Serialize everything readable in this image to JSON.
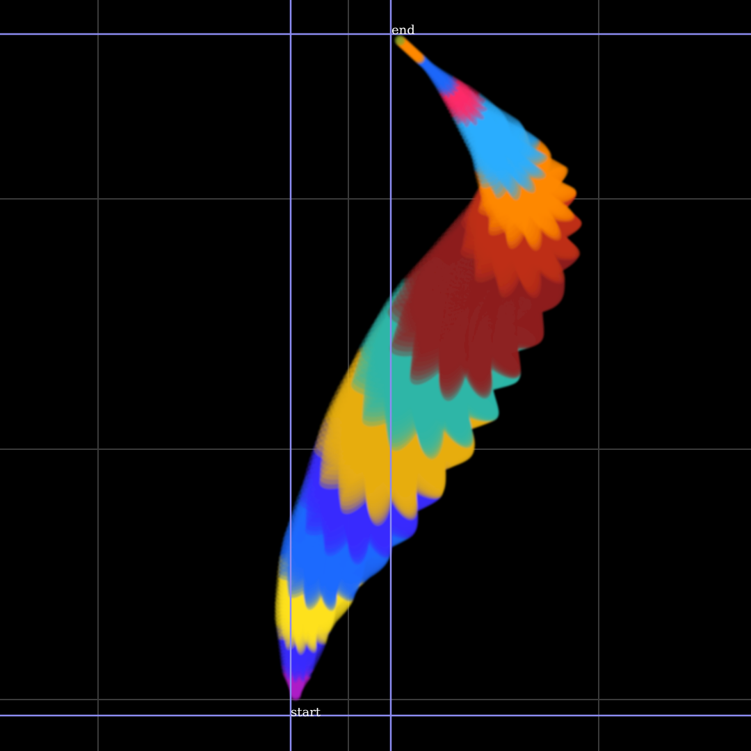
{
  "labels": {
    "start": "start",
    "end": "end"
  },
  "colors": {
    "background": "#000000",
    "grid": "#3a3a3a",
    "guide": "#8c8cf2",
    "label": "#ffffff"
  }
}
